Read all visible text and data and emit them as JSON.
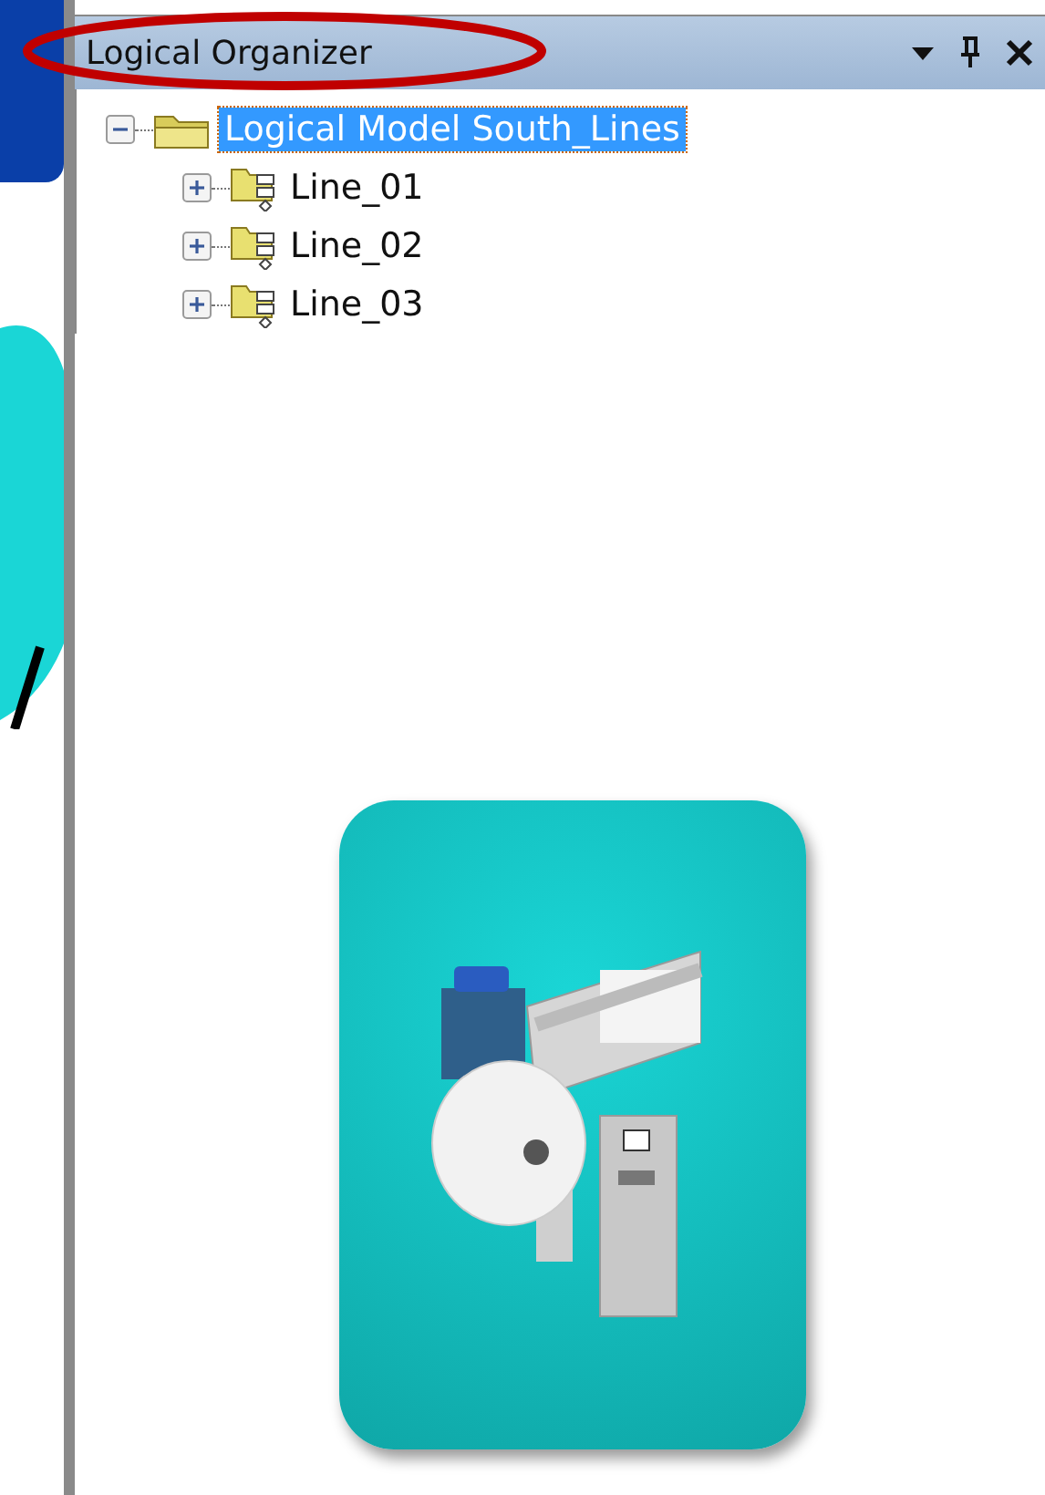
{
  "panel": {
    "title": "Logical Organizer"
  },
  "tree": [
    {
      "label": "Logical Model South_Lines",
      "selected": true,
      "expanded": true,
      "children": [
        {
          "label": "Line_01",
          "selected": false,
          "expanded": false
        },
        {
          "label": "Line_02",
          "selected": false,
          "expanded": false
        },
        {
          "label": "Line_03",
          "selected": false,
          "expanded": false
        }
      ]
    }
  ]
}
